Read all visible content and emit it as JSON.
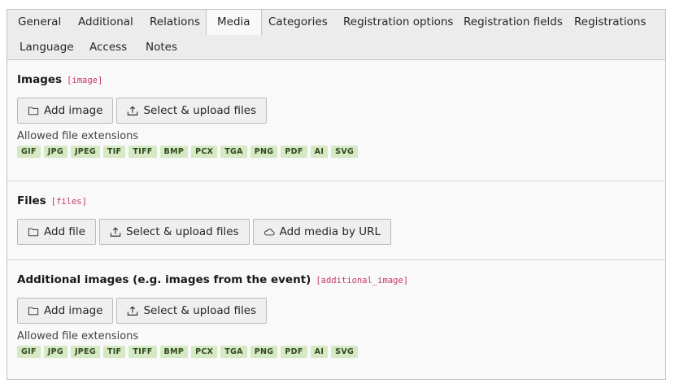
{
  "tabs": [
    {
      "label": "General"
    },
    {
      "label": "Additional"
    },
    {
      "label": "Relations"
    },
    {
      "label": "Media",
      "active": true
    },
    {
      "label": "Categories"
    },
    {
      "label": "Registration options"
    },
    {
      "label": "Registration fields"
    },
    {
      "label": "Registrations"
    },
    {
      "label": "Language"
    },
    {
      "label": "Access"
    },
    {
      "label": "Notes"
    }
  ],
  "sections": [
    {
      "title": "Images",
      "code": "[image]",
      "buttons": [
        {
          "label": "Add image",
          "icon": "folder-icon"
        },
        {
          "label": "Select & upload files",
          "icon": "upload-icon"
        }
      ],
      "allowed_label": "Allowed file extensions",
      "extensions": [
        "GIF",
        "JPG",
        "JPEG",
        "TIF",
        "TIFF",
        "BMP",
        "PCX",
        "TGA",
        "PNG",
        "PDF",
        "AI",
        "SVG"
      ]
    },
    {
      "title": "Files",
      "code": "[files]",
      "buttons": [
        {
          "label": "Add file",
          "icon": "folder-icon"
        },
        {
          "label": "Select & upload files",
          "icon": "upload-icon"
        },
        {
          "label": "Add media by URL",
          "icon": "cloud-icon"
        }
      ]
    },
    {
      "title": "Additional images (e.g. images from the event)",
      "code": "[additional_image]",
      "buttons": [
        {
          "label": "Add image",
          "icon": "folder-icon"
        },
        {
          "label": "Select & upload files",
          "icon": "upload-icon"
        }
      ],
      "allowed_label": "Allowed file extensions",
      "extensions": [
        "GIF",
        "JPG",
        "JPEG",
        "TIF",
        "TIFF",
        "BMP",
        "PCX",
        "TGA",
        "PNG",
        "PDF",
        "AI",
        "SVG"
      ]
    }
  ],
  "colors": {
    "tab_bar": "#ececec",
    "panel": "#f9f9f9",
    "code_accent": "#c8356b",
    "extension_badge": "#d6e9c5"
  }
}
